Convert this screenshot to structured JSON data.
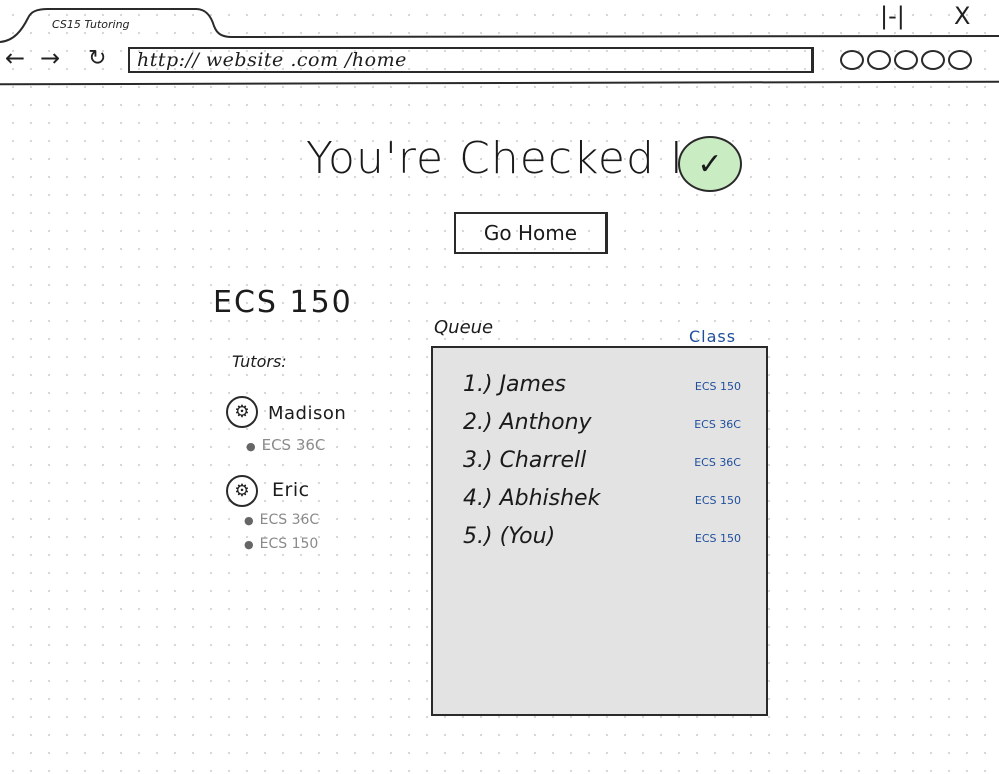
{
  "browser": {
    "tab_title": "CS15 Tutoring",
    "url": "http:// website .com /home",
    "minimize_glyph": "|-|",
    "close_glyph": "X",
    "icons": [
      "back-arrow-icon",
      "forward-arrow-icon",
      "refresh-icon"
    ]
  },
  "page": {
    "headline": "You're Checked In!",
    "home_button": "Go Home",
    "course": "ECS 150"
  },
  "tutors": {
    "label": "Tutors:",
    "items": [
      {
        "name": "Madison",
        "courses": [
          "ECS 36C"
        ]
      },
      {
        "name": "Eric",
        "courses": [
          "ECS 36C",
          "ECS 150"
        ]
      }
    ]
  },
  "queue": {
    "label": "Queue",
    "class_header": "Class",
    "rows": [
      {
        "entry": "1.) James",
        "class": "ECS 150"
      },
      {
        "entry": "2.) Anthony",
        "class": "ECS 36C"
      },
      {
        "entry": "3.) Charrell",
        "class": "ECS 36C"
      },
      {
        "entry": "4.) Abhishek",
        "class": "ECS 150"
      },
      {
        "entry": "5.) (You)",
        "class": "ECS 150"
      }
    ]
  },
  "colors": {
    "accent_blue": "#1f4e9c",
    "check_green": "#c9ecc2",
    "queue_bg": "#e3e3e3"
  }
}
